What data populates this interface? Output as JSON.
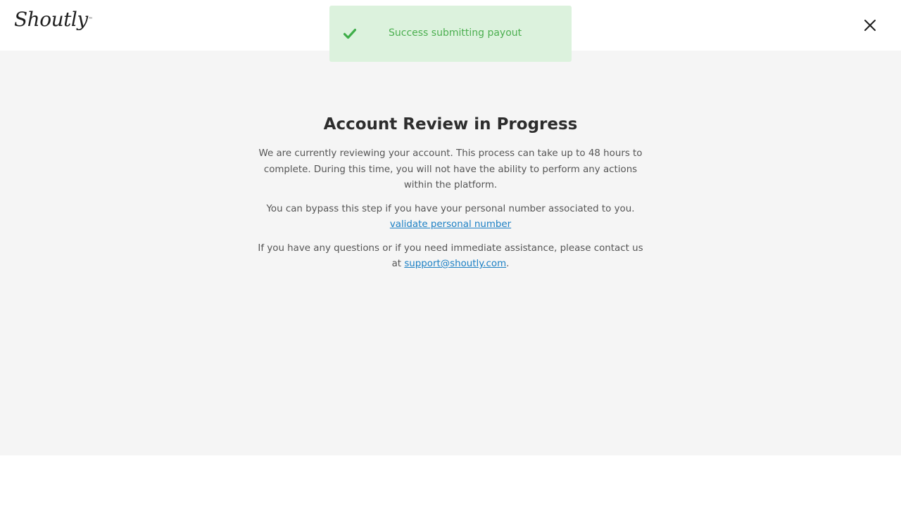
{
  "header": {
    "logo_text": "Shoutly",
    "logo_tm": "™",
    "close_icon": "close-icon"
  },
  "toast": {
    "icon": "check-icon",
    "message": "Success submitting payout",
    "color": "#4caf50",
    "background": "#dcf2dd"
  },
  "review": {
    "title": "Account Review in Progress",
    "paragraph1": "We are currently reviewing your account. This process can take up to 48 hours to complete. During this time, you will not have the ability to perform any actions within the platform.",
    "paragraph2": "You can bypass this step if you have your personal number associated to you.",
    "validate_link": "validate personal number",
    "paragraph3_prefix": "If you have any questions or if you need immediate assistance, please contact us at",
    "support_email": "support@shoutly.com",
    "paragraph3_suffix": "."
  },
  "colors": {
    "link": "#1a7fc4",
    "content_background": "#f5f5f5",
    "title": "#2d2d2d"
  }
}
